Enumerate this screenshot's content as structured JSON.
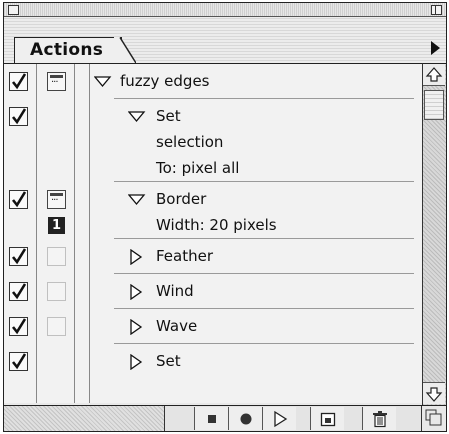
{
  "palette": {
    "tab_label": "Actions"
  },
  "actions": [
    {
      "label": "fuzzy edges",
      "expanded": true,
      "level": 0,
      "checked": true,
      "dialog": "on",
      "badge": ""
    },
    {
      "label": "Set",
      "expanded": true,
      "level": 1,
      "checked": true,
      "dialog": "none",
      "badge": "",
      "details": [
        "selection",
        "To: pixel all"
      ]
    },
    {
      "label": "Border",
      "expanded": true,
      "level": 1,
      "checked": true,
      "dialog": "on",
      "badge": "1",
      "details": [
        "Width: 20 pixels"
      ]
    },
    {
      "label": "Feather",
      "expanded": false,
      "level": 1,
      "checked": true,
      "dialog": "off",
      "badge": ""
    },
    {
      "label": "Wind",
      "expanded": false,
      "level": 1,
      "checked": true,
      "dialog": "off",
      "badge": ""
    },
    {
      "label": "Wave",
      "expanded": false,
      "level": 1,
      "checked": true,
      "dialog": "off",
      "badge": ""
    },
    {
      "label": "Set",
      "expanded": false,
      "level": 1,
      "checked": true,
      "dialog": "none",
      "badge": ""
    }
  ],
  "toolbar": {
    "buttons": [
      "stop-icon",
      "record-icon",
      "play-icon",
      "new-action-icon",
      "trash-icon"
    ]
  },
  "colors": {
    "frame": "#222222",
    "panel": "#f2f2f2",
    "badge": "#222222"
  }
}
